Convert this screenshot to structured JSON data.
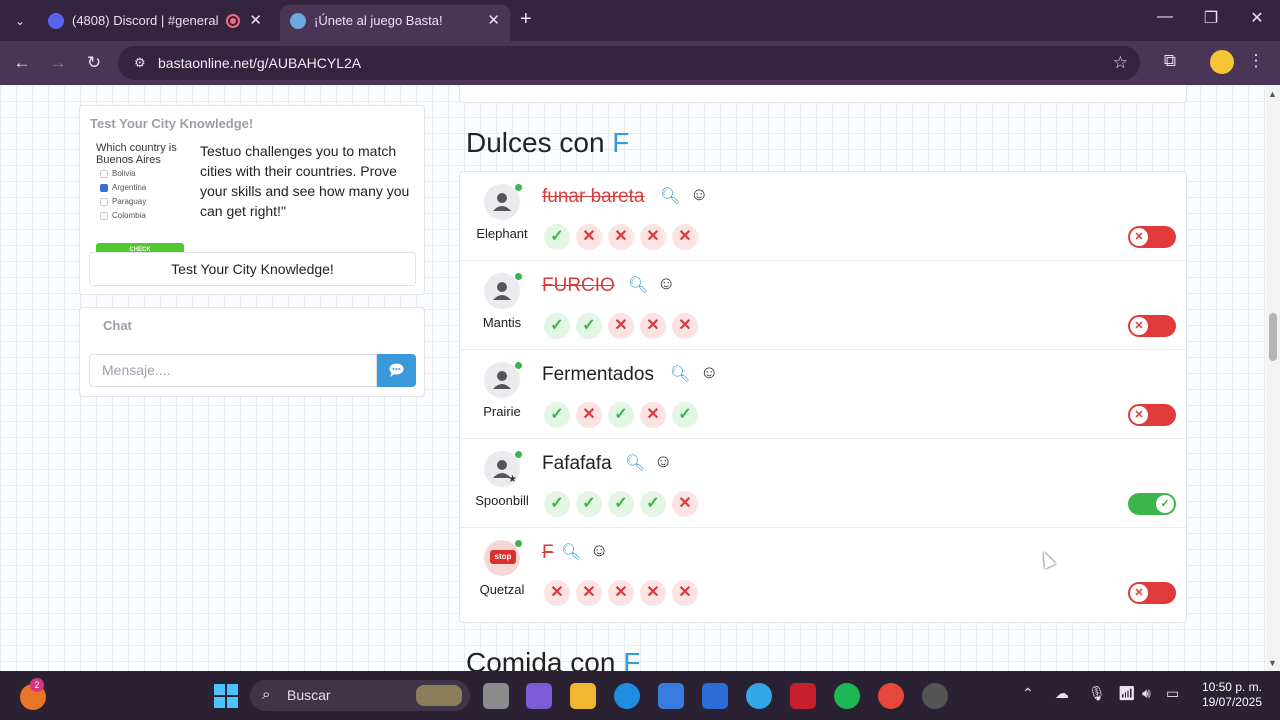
{
  "browser": {
    "tabs": [
      {
        "title": "(4808) Discord | #general |",
        "active": false
      },
      {
        "title": "¡Únete al juego Basta!",
        "active": true
      }
    ],
    "url": "bastaonline.net/g/AUBAHCYL2A"
  },
  "ad": {
    "title": "Test Your City Knowledge!",
    "question": "Which country is Buenos Aires",
    "options": [
      "Bolivia",
      "Argentina",
      "Paraguay",
      "Colombia"
    ],
    "check_label": "CHECK",
    "description": "Testuo challenges you to match cities with their countries. Prove your skills and see how many you can get right!\"",
    "button_label": "Test Your City Knowledge!"
  },
  "chat": {
    "title": "Chat",
    "placeholder": "Mensaje...."
  },
  "sections": {
    "dulces": {
      "prefix": "Dulces con",
      "letter": "F"
    },
    "comida": {
      "prefix": "Comida con",
      "letter": "F"
    }
  },
  "answers": [
    {
      "player": "Elephant",
      "answer": "funar bareta",
      "rejected": true,
      "votes": [
        "yes",
        "no",
        "no",
        "no",
        "no"
      ],
      "accepted": false
    },
    {
      "player": "Mantis",
      "answer": "FURCIO",
      "rejected": true,
      "votes": [
        "yes",
        "yes",
        "no",
        "no",
        "no"
      ],
      "accepted": false
    },
    {
      "player": "Prairie",
      "answer": "Fermentados",
      "rejected": false,
      "votes": [
        "yes",
        "no",
        "yes",
        "no",
        "yes"
      ],
      "accepted": false
    },
    {
      "player": "Spoonbill",
      "answer": "Fafafafa",
      "rejected": false,
      "votes": [
        "yes",
        "yes",
        "yes",
        "yes",
        "no"
      ],
      "accepted": true
    },
    {
      "player": "Quetzal",
      "answer": "F",
      "rejected": true,
      "votes": [
        "no",
        "no",
        "no",
        "no",
        "no"
      ],
      "accepted": false
    }
  ],
  "stop_label": "stop",
  "taskbar": {
    "search_label": "Buscar",
    "notification_count": "2",
    "time": "10:50 p. m.",
    "date": "19/07/2025"
  },
  "colors": {
    "accent": "#3a9ad9",
    "accept": "#3cb54a",
    "reject": "#e13a3a"
  }
}
